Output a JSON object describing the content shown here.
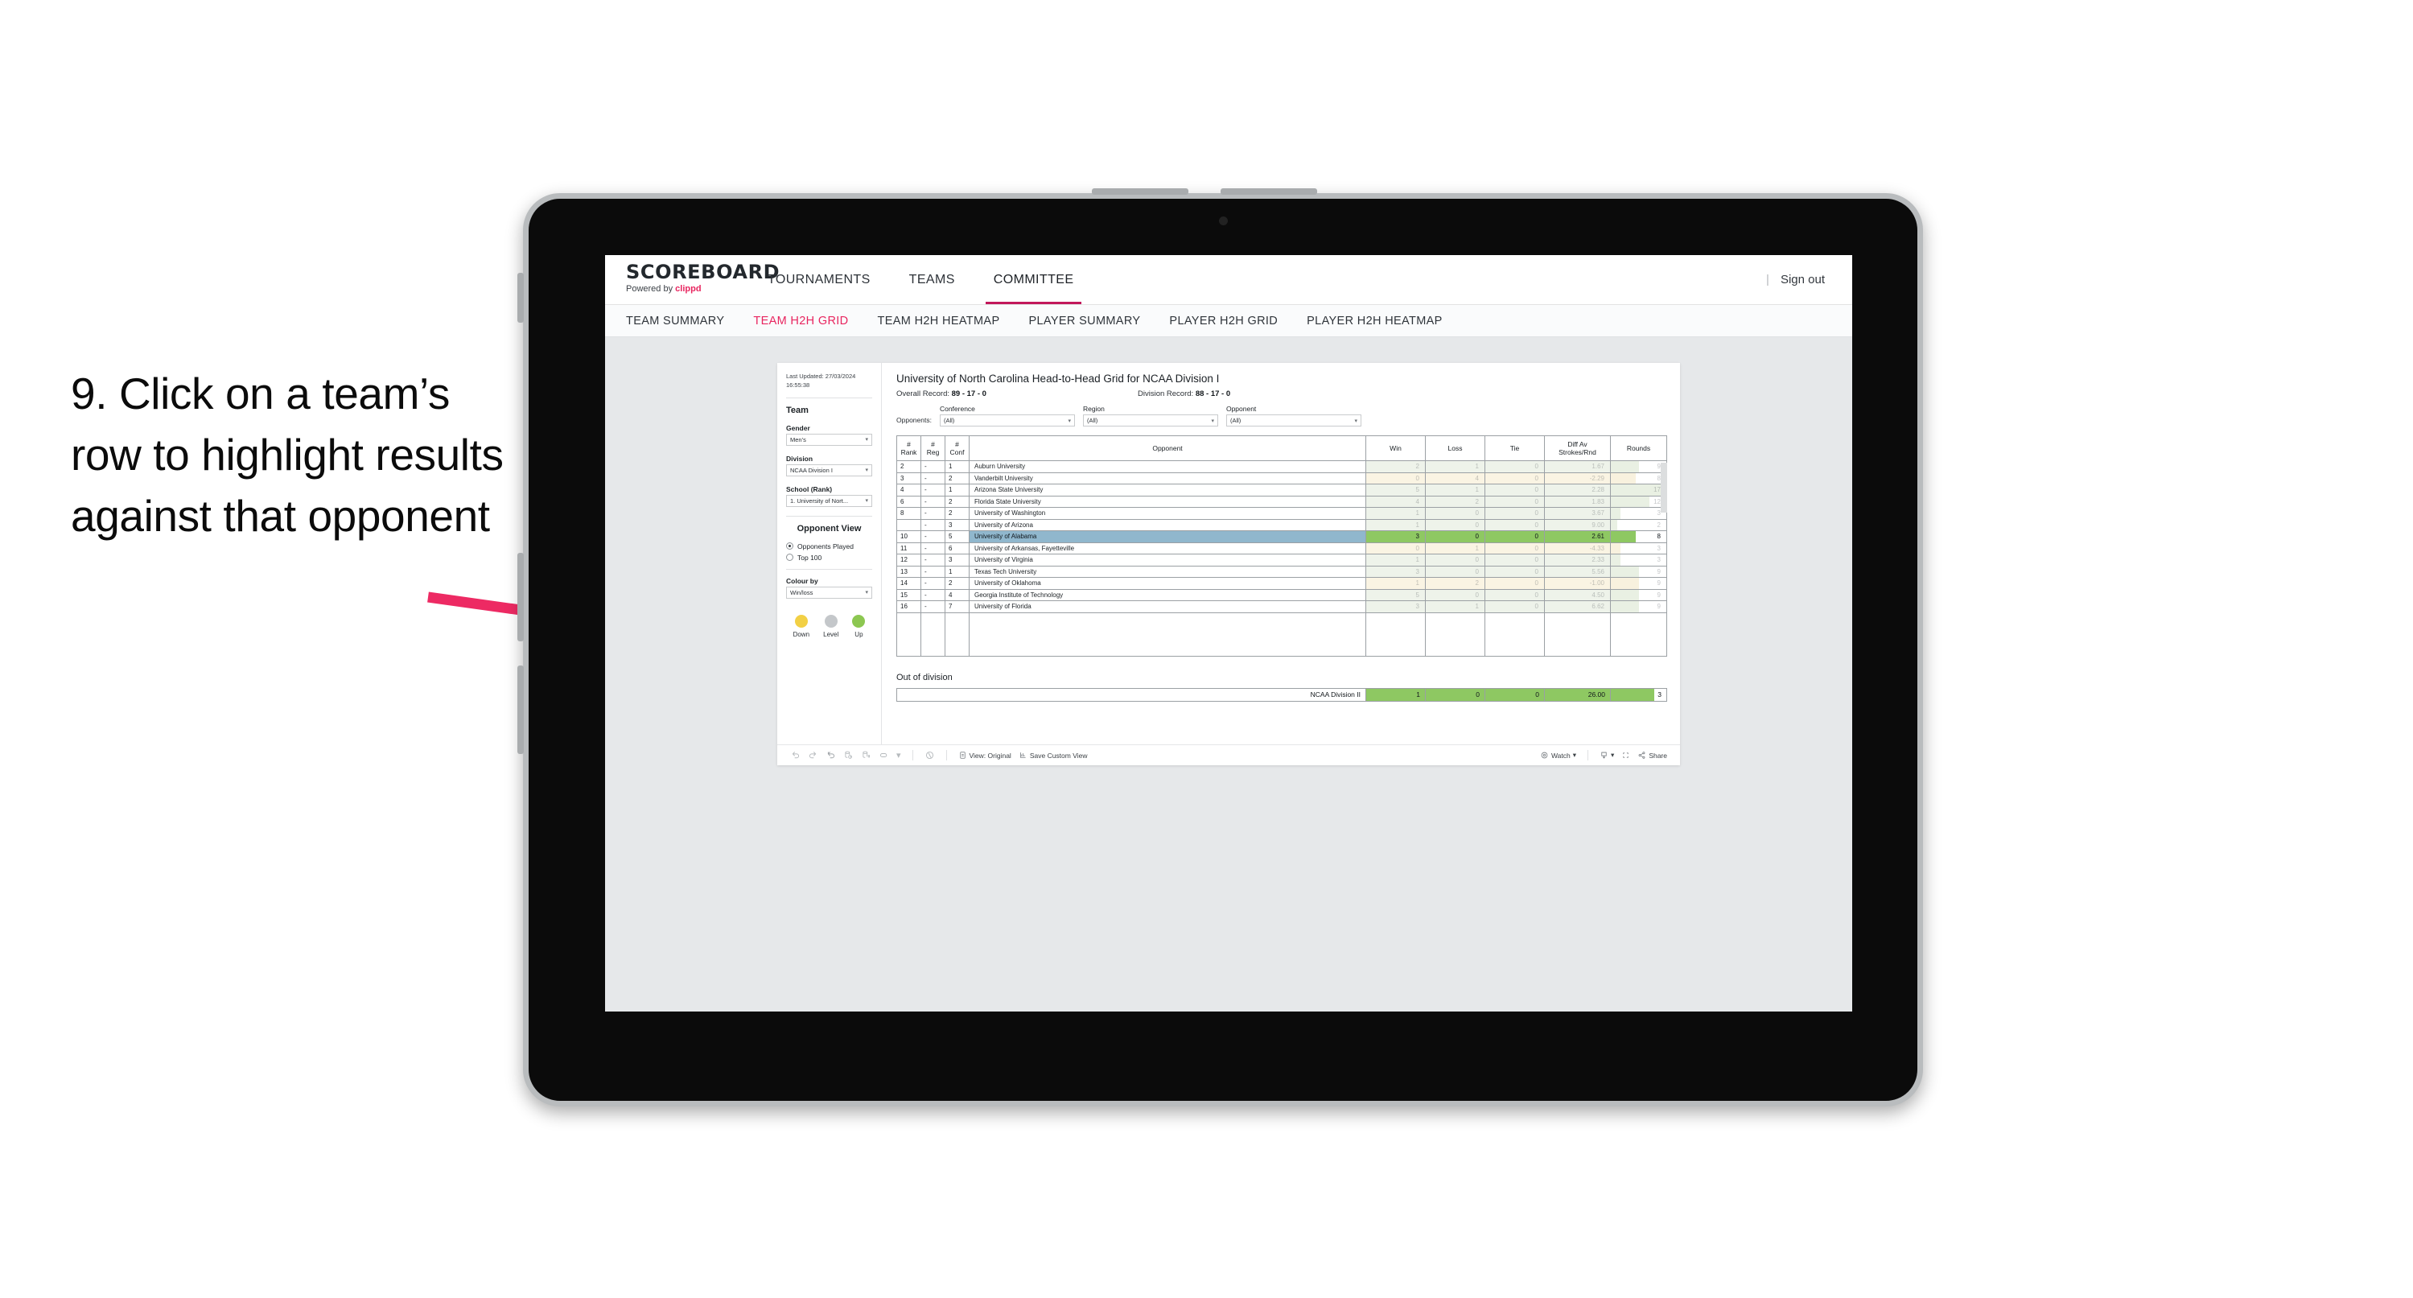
{
  "callout": {
    "text": "9. Click on a team’s row to highlight results against that opponent"
  },
  "topnav": {
    "brand_title": "SCOREBOARD",
    "brand_sub_prefix": "Powered by ",
    "brand_sub_brand": "clippd",
    "items": [
      {
        "label": "TOURNAMENTS",
        "active": false
      },
      {
        "label": "TEAMS",
        "active": false
      },
      {
        "label": "COMMITTEE",
        "active": true
      }
    ],
    "separator": "|",
    "signout_label": "Sign out"
  },
  "subnav": {
    "items": [
      {
        "label": "TEAM SUMMARY",
        "active": false
      },
      {
        "label": "TEAM H2H GRID",
        "active": true
      },
      {
        "label": "TEAM H2H HEATMAP",
        "active": false
      },
      {
        "label": "PLAYER SUMMARY",
        "active": false
      },
      {
        "label": "PLAYER H2H GRID",
        "active": false
      },
      {
        "label": "PLAYER H2H HEATMAP",
        "active": false
      }
    ]
  },
  "sidebar": {
    "last_updated": "Last Updated: 27/03/2024 16:55:38",
    "team_heading": "Team",
    "gender_label": "Gender",
    "gender_value": "Men’s",
    "division_label": "Division",
    "division_value": "NCAA Division I",
    "school_label": "School (Rank)",
    "school_value": "1. University of Nort...",
    "opponent_view_heading": "Opponent View",
    "opponent_view_options": [
      {
        "label": "Opponents Played",
        "selected": true
      },
      {
        "label": "Top 100",
        "selected": false
      }
    ],
    "colour_by_label": "Colour by",
    "colour_by_value": "Win/loss",
    "legend": [
      {
        "label": "Down",
        "color": "#f2d045"
      },
      {
        "label": "Level",
        "color": "#c4c7ca"
      },
      {
        "label": "Up",
        "color": "#8cc751"
      }
    ]
  },
  "main": {
    "title": "University of North Carolina Head-to-Head Grid for NCAA Division I",
    "overall_record_label": "Overall Record:",
    "overall_record_value": "89 - 17 - 0",
    "division_record_label": "Division Record:",
    "division_record_value": "88 - 17 - 0",
    "opponents_label": "Opponents:",
    "filters": [
      {
        "label": "Conference",
        "value": "(All)"
      },
      {
        "label": "Region",
        "value": "(All)"
      },
      {
        "label": "Opponent",
        "value": "(All)"
      }
    ],
    "columns": [
      "# Rank",
      "# Reg",
      "# Conf",
      "Opponent",
      "Win",
      "Loss",
      "Tie",
      "Diff Av Strokes/Rnd",
      "Rounds"
    ],
    "columns_split": [
      {
        "l1": "#",
        "l2": "Rank"
      },
      {
        "l1": "#",
        "l2": "Reg"
      },
      {
        "l1": "#",
        "l2": "Conf"
      },
      {
        "l1": "Opponent",
        "l2": ""
      },
      {
        "l1": "Win",
        "l2": ""
      },
      {
        "l1": "Loss",
        "l2": ""
      },
      {
        "l1": "Tie",
        "l2": ""
      },
      {
        "l1": "Diff Av",
        "l2": "Strokes/Rnd"
      },
      {
        "l1": "Rounds",
        "l2": ""
      }
    ],
    "rows": [
      {
        "rank": "2",
        "reg": "-",
        "conf": "1",
        "opponent": "Auburn University",
        "win": "2",
        "loss": "1",
        "tie": "0",
        "diff": "1.67",
        "rounds": "9",
        "result": "win",
        "highlighted": false,
        "bar_pct": 50
      },
      {
        "rank": "3",
        "reg": "-",
        "conf": "2",
        "opponent": "Vanderbilt University",
        "win": "0",
        "loss": "4",
        "tie": "0",
        "diff": "-2.29",
        "rounds": "8",
        "result": "loss",
        "highlighted": false,
        "bar_pct": 45
      },
      {
        "rank": "4",
        "reg": "-",
        "conf": "1",
        "opponent": "Arizona State University",
        "win": "5",
        "loss": "1",
        "tie": "0",
        "diff": "2.28",
        "rounds": "17",
        "result": "win",
        "highlighted": false,
        "bar_pct": 97
      },
      {
        "rank": "6",
        "reg": "-",
        "conf": "2",
        "opponent": "Florida State University",
        "win": "4",
        "loss": "2",
        "tie": "0",
        "diff": "1.83",
        "rounds": "12",
        "result": "win",
        "highlighted": false,
        "bar_pct": 70
      },
      {
        "rank": "8",
        "reg": "-",
        "conf": "2",
        "opponent": "University of Washington",
        "win": "1",
        "loss": "0",
        "tie": "0",
        "diff": "3.67",
        "rounds": "3",
        "result": "win",
        "highlighted": false,
        "bar_pct": 17
      },
      {
        "rank": "",
        "reg": "-",
        "conf": "3",
        "opponent": "University of Arizona",
        "win": "1",
        "loss": "0",
        "tie": "0",
        "diff": "9.00",
        "rounds": "2",
        "result": "win",
        "highlighted": false,
        "bar_pct": 11
      },
      {
        "rank": "10",
        "reg": "-",
        "conf": "5",
        "opponent": "University of Alabama",
        "win": "3",
        "loss": "0",
        "tie": "0",
        "diff": "2.61",
        "rounds": "8",
        "result": "win",
        "highlighted": true,
        "bar_pct": 45
      },
      {
        "rank": "11",
        "reg": "-",
        "conf": "6",
        "opponent": "University of Arkansas, Fayetteville",
        "win": "0",
        "loss": "1",
        "tie": "0",
        "diff": "-4.33",
        "rounds": "3",
        "result": "loss",
        "highlighted": false,
        "bar_pct": 17
      },
      {
        "rank": "12",
        "reg": "-",
        "conf": "3",
        "opponent": "University of Virginia",
        "win": "1",
        "loss": "0",
        "tie": "0",
        "diff": "2.33",
        "rounds": "3",
        "result": "win",
        "highlighted": false,
        "bar_pct": 17
      },
      {
        "rank": "13",
        "reg": "-",
        "conf": "1",
        "opponent": "Texas Tech University",
        "win": "3",
        "loss": "0",
        "tie": "0",
        "diff": "5.56",
        "rounds": "9",
        "result": "win",
        "highlighted": false,
        "bar_pct": 50
      },
      {
        "rank": "14",
        "reg": "-",
        "conf": "2",
        "opponent": "University of Oklahoma",
        "win": "1",
        "loss": "2",
        "tie": "0",
        "diff": "-1.00",
        "rounds": "9",
        "result": "loss",
        "highlighted": false,
        "bar_pct": 50
      },
      {
        "rank": "15",
        "reg": "-",
        "conf": "4",
        "opponent": "Georgia Institute of Technology",
        "win": "5",
        "loss": "0",
        "tie": "0",
        "diff": "4.50",
        "rounds": "9",
        "result": "win",
        "highlighted": false,
        "bar_pct": 50
      },
      {
        "rank": "16",
        "reg": "-",
        "conf": "7",
        "opponent": "University of Florida",
        "win": "3",
        "loss": "1",
        "tie": "0",
        "diff": "6.62",
        "rounds": "9",
        "result": "win",
        "highlighted": false,
        "bar_pct": 50
      }
    ],
    "out_of_division_title": "Out of division",
    "out_of_division_row": {
      "name": "NCAA Division II",
      "win": "1",
      "loss": "0",
      "tie": "0",
      "diff": "26.00",
      "rounds": "3"
    }
  },
  "toolbar": {
    "view_label": "View: Original",
    "save_label": "Save Custom View",
    "watch_label": "Watch",
    "share_label": "Share"
  },
  "colors": {
    "accent_pink": "#e8255f",
    "tab_underline": "#c2185b",
    "highlight_row": "#90b7cd",
    "win_green": "#8ec862",
    "arrow": "#ed2a63"
  }
}
